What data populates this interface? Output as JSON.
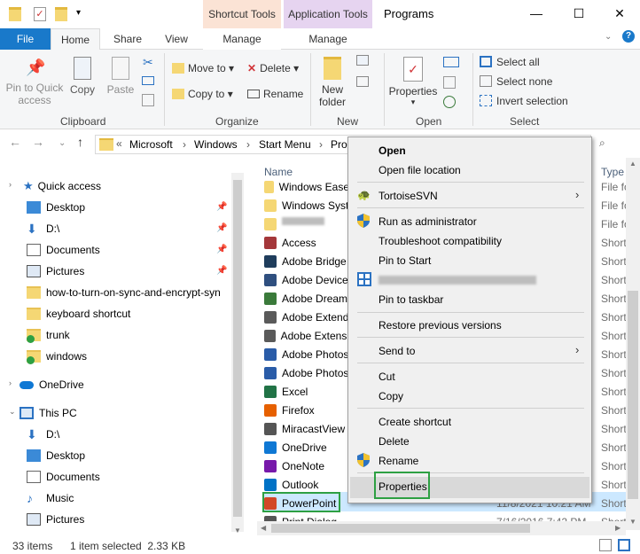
{
  "window": {
    "title": "Programs",
    "contextual_tabs": {
      "shortcut_tools": "Shortcut Tools",
      "application_tools": "Application Tools"
    },
    "controls": {
      "minimize": "—",
      "maximize": "☐",
      "close": "✕"
    }
  },
  "ribbon_tabs": [
    "File",
    "Home",
    "Share",
    "View",
    "Manage",
    "Manage"
  ],
  "ribbon": {
    "clipboard": {
      "pin_label_1": "Pin to Quick",
      "pin_label_2": "access",
      "copy": "Copy",
      "paste": "Paste",
      "group": "Clipboard"
    },
    "organize": {
      "move_to": "Move to",
      "delete": "Delete",
      "copy_to": "Copy to",
      "rename": "Rename",
      "group": "Organize"
    },
    "new": {
      "new_folder_1": "New",
      "new_folder_2": "folder",
      "group": "New"
    },
    "open": {
      "properties": "Properties",
      "group": "Open"
    },
    "select": {
      "select_all": "Select all",
      "select_none": "Select none",
      "invert": "Invert selection",
      "group": "Select"
    }
  },
  "address": {
    "prefix": "«",
    "crumbs": [
      "Microsoft",
      "Windows",
      "Start Menu",
      "Pro"
    ]
  },
  "nav": {
    "items": [
      {
        "label": "Quick access",
        "type": "star"
      },
      {
        "label": "Desktop",
        "type": "desk"
      },
      {
        "label": "D:\\",
        "type": "down"
      },
      {
        "label": "Documents",
        "type": "doc"
      },
      {
        "label": "Pictures",
        "type": "pic"
      },
      {
        "label": "how-to-turn-on-sync-and-encrypt-syn",
        "type": "folder"
      },
      {
        "label": "keyboard shortcut",
        "type": "folder"
      },
      {
        "label": "trunk",
        "type": "svn"
      },
      {
        "label": "windows",
        "type": "svn"
      },
      {
        "label": "OneDrive",
        "type": "cloud"
      },
      {
        "label": "This PC",
        "type": "pc"
      },
      {
        "label": "D:\\",
        "type": "down"
      },
      {
        "label": "Desktop",
        "type": "desk"
      },
      {
        "label": "Documents",
        "type": "doc"
      },
      {
        "label": "Music",
        "type": "music"
      },
      {
        "label": "Pictures",
        "type": "pic"
      }
    ]
  },
  "columns": {
    "name": "Name",
    "type": "Type"
  },
  "files": [
    {
      "name": "Windows Ease",
      "type": "File fo",
      "icon_color": "#f5d774"
    },
    {
      "name": "Windows Syst",
      "type": "File fo",
      "icon_color": "#f5d774"
    },
    {
      "name": "",
      "type": "File fo",
      "icon_color": "#f5d774"
    },
    {
      "name": "Access",
      "type": "Short",
      "icon_color": "#a4373a"
    },
    {
      "name": "Adobe Bridge",
      "type": "Short",
      "icon_color": "#1f3d5c"
    },
    {
      "name": "Adobe Device",
      "type": "Short",
      "icon_color": "#2f4f7f"
    },
    {
      "name": "Adobe Dream",
      "type": "Short",
      "icon_color": "#3a7a3a"
    },
    {
      "name": "Adobe Extend",
      "type": "Short",
      "icon_color": "#5a5a5a"
    },
    {
      "name": "Adobe Extensi",
      "type": "Short",
      "icon_color": "#5a5a5a"
    },
    {
      "name": "Adobe Photos",
      "type": "Short",
      "icon_color": "#2a5ca8"
    },
    {
      "name": "Adobe Photos",
      "type": "Short",
      "icon_color": "#2a5ca8"
    },
    {
      "name": "Excel",
      "type": "Short",
      "icon_color": "#217346"
    },
    {
      "name": "Firefox",
      "type": "Short",
      "icon_color": "#e66000"
    },
    {
      "name": "MiracastView",
      "type": "Short",
      "icon_color": "#555555"
    },
    {
      "name": "OneDrive",
      "type": "Short",
      "icon_color": "#0f78d4"
    },
    {
      "name": "OneNote",
      "type": "Short",
      "icon_color": "#7719aa"
    },
    {
      "name": "Outlook",
      "type": "Short",
      "icon_color": "#0072c6"
    },
    {
      "name": "PowerPoint",
      "type": "Short",
      "icon_color": "#d24726",
      "date": "11/8/2021 10:21 AM"
    },
    {
      "name": "Print Dialog",
      "type": "Short",
      "icon_color": "#555555",
      "date": "7/16/2016 7:42 PM"
    }
  ],
  "context_menu": {
    "open": "Open",
    "open_location": "Open file location",
    "tortoise": "TortoiseSVN",
    "run_admin": "Run as administrator",
    "troubleshoot": "Troubleshoot compatibility",
    "pin_start": "Pin to Start",
    "pin_taskbar": "Pin to taskbar",
    "restore": "Restore previous versions",
    "send_to": "Send to",
    "cut": "Cut",
    "copy": "Copy",
    "create_shortcut": "Create shortcut",
    "delete": "Delete",
    "rename": "Rename",
    "properties": "Properties"
  },
  "status": {
    "count": "33 items",
    "selected": "1 item selected  2.33 KB"
  },
  "colors": {
    "accent": "#1979ca",
    "highlight_border": "#2ea043",
    "selection": "#cce8ff"
  }
}
